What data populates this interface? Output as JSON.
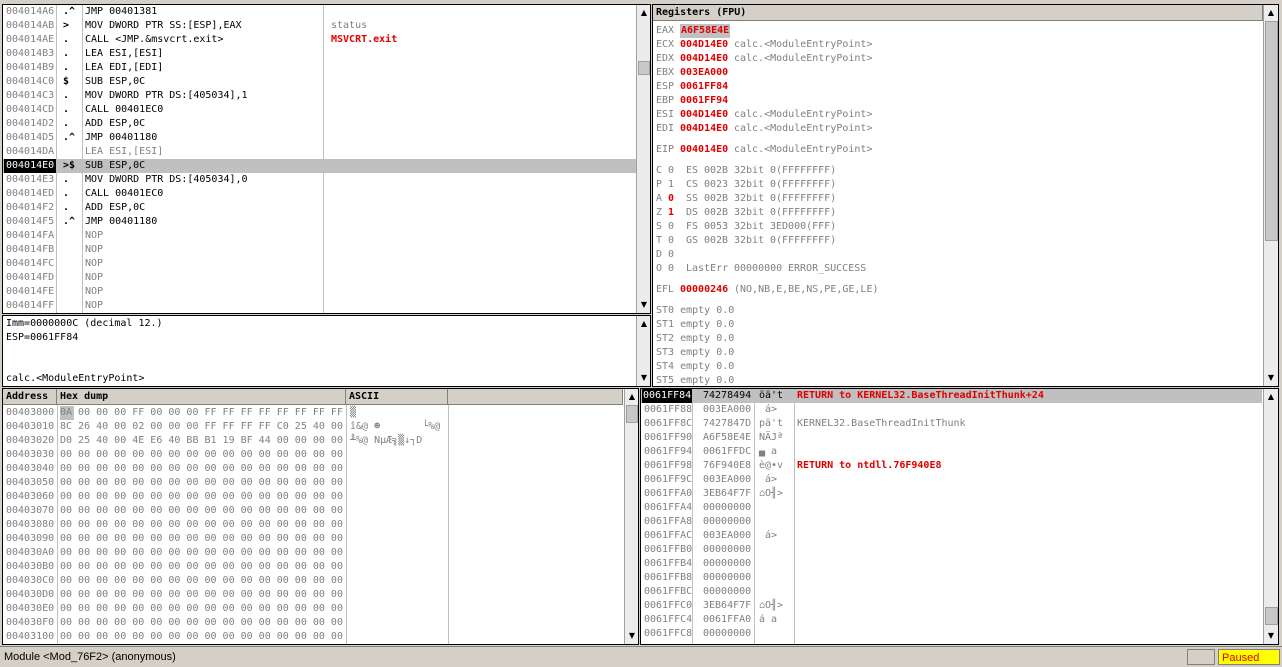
{
  "disasm": {
    "rows": [
      {
        "addr": "004014A6",
        "mark": ".^",
        "instr": "JMP 00401381",
        "comment": "",
        "addr_style": "gray"
      },
      {
        "addr": "004014AB",
        "mark": ">",
        "instr": "MOV DWORD PTR SS:[ESP],EAX",
        "comment": "status",
        "addr_style": "gray"
      },
      {
        "addr": "004014AE",
        "mark": ".",
        "instr": "CALL <JMP.&msvcrt.exit>",
        "comment": "MSVCRT.exit",
        "addr_style": "gray"
      },
      {
        "addr": "004014B3",
        "mark": ".",
        "instr": "LEA ESI,[ESI]",
        "comment": "",
        "addr_style": "gray"
      },
      {
        "addr": "004014B9",
        "mark": ".",
        "instr": "LEA EDI,[EDI]",
        "comment": "",
        "addr_style": "gray"
      },
      {
        "addr": "004014C0",
        "mark": "$",
        "instr": "SUB ESP,0C",
        "comment": "",
        "addr_style": "gray"
      },
      {
        "addr": "004014C3",
        "mark": ".",
        "instr": "MOV DWORD PTR DS:[405034],1",
        "comment": "",
        "addr_style": "gray"
      },
      {
        "addr": "004014CD",
        "mark": ".",
        "instr": "CALL 00401EC0",
        "comment": "",
        "addr_style": "gray"
      },
      {
        "addr": "004014D2",
        "mark": ".",
        "instr": "ADD ESP,0C",
        "comment": "",
        "addr_style": "gray"
      },
      {
        "addr": "004014D5",
        "mark": ".^",
        "instr": "JMP 00401180",
        "comment": "",
        "addr_style": "gray"
      },
      {
        "addr": "004014DA",
        "mark": "",
        "instr": "LEA ESI,[ESI]",
        "comment": "",
        "addr_style": "gray"
      },
      {
        "addr": "004014E0",
        "mark": ">$",
        "instr": "SUB ESP,0C",
        "comment": "",
        "addr_style": "current"
      },
      {
        "addr": "004014E3",
        "mark": ".",
        "instr": "MOV DWORD PTR DS:[405034],0",
        "comment": "",
        "addr_style": "gray"
      },
      {
        "addr": "004014ED",
        "mark": ".",
        "instr": "CALL 00401EC0",
        "comment": "",
        "addr_style": "gray"
      },
      {
        "addr": "004014F2",
        "mark": ".",
        "instr": "ADD ESP,0C",
        "comment": "",
        "addr_style": "gray"
      },
      {
        "addr": "004014F5",
        "mark": ".^",
        "instr": "JMP 00401180",
        "comment": "",
        "addr_style": "gray"
      },
      {
        "addr": "004014FA",
        "mark": "",
        "instr": "NOP",
        "comment": "",
        "addr_style": "gray"
      },
      {
        "addr": "004014FB",
        "mark": "",
        "instr": "NOP",
        "comment": "",
        "addr_style": "gray"
      },
      {
        "addr": "004014FC",
        "mark": "",
        "instr": "NOP",
        "comment": "",
        "addr_style": "gray"
      },
      {
        "addr": "004014FD",
        "mark": "",
        "instr": "NOP",
        "comment": "",
        "addr_style": "gray"
      },
      {
        "addr": "004014FE",
        "mark": "",
        "instr": "NOP",
        "comment": "",
        "addr_style": "gray"
      },
      {
        "addr": "004014FF",
        "mark": "",
        "instr": "NOP",
        "comment": "",
        "addr_style": "gray"
      }
    ]
  },
  "info": {
    "line1": "Imm=0000000C (decimal 12.)",
    "line2": "ESP=0061FF84",
    "line3": "calc.<ModuleEntryPoint>"
  },
  "registers": {
    "title": "Registers (FPU)",
    "gpr": [
      {
        "name": "EAX",
        "value": "A6F58E4E",
        "desc": "",
        "highlight": true
      },
      {
        "name": "ECX",
        "value": "004D14E0",
        "desc": "calc.<ModuleEntryPoint>"
      },
      {
        "name": "EDX",
        "value": "004D14E0",
        "desc": "calc.<ModuleEntryPoint>"
      },
      {
        "name": "EBX",
        "value": "003EA000",
        "desc": ""
      },
      {
        "name": "ESP",
        "value": "0061FF84",
        "desc": ""
      },
      {
        "name": "EBP",
        "value": "0061FF94",
        "desc": ""
      },
      {
        "name": "ESI",
        "value": "004D14E0",
        "desc": "calc.<ModuleEntryPoint>"
      },
      {
        "name": "EDI",
        "value": "004D14E0",
        "desc": "calc.<ModuleEntryPoint>"
      }
    ],
    "eip": {
      "name": "EIP",
      "value": "004014E0",
      "desc": "calc.<ModuleEntryPoint>"
    },
    "flags": [
      {
        "flag": "C",
        "val": "0",
        "seg": "ES",
        "sel": "002B",
        "bits": "32bit",
        "range": "0(FFFFFFFF)",
        "red": false
      },
      {
        "flag": "P",
        "val": "1",
        "seg": "CS",
        "sel": "0023",
        "bits": "32bit",
        "range": "0(FFFFFFFF)",
        "red": false
      },
      {
        "flag": "A",
        "val": "0",
        "seg": "SS",
        "sel": "002B",
        "bits": "32bit",
        "range": "0(FFFFFFFF)",
        "red": true
      },
      {
        "flag": "Z",
        "val": "1",
        "seg": "DS",
        "sel": "002B",
        "bits": "32bit",
        "range": "0(FFFFFFFF)",
        "red": true
      },
      {
        "flag": "S",
        "val": "0",
        "seg": "FS",
        "sel": "0053",
        "bits": "32bit",
        "range": "3ED000(FFF)",
        "red": false
      },
      {
        "flag": "T",
        "val": "0",
        "seg": "GS",
        "sel": "002B",
        "bits": "32bit",
        "range": "0(FFFFFFFF)",
        "red": false
      },
      {
        "flag": "D",
        "val": "0",
        "seg": "",
        "sel": "",
        "bits": "",
        "range": "",
        "red": false
      },
      {
        "flag": "O",
        "val": "0",
        "seg": "LastErr",
        "sel": "00000000",
        "bits": "ERROR_SUCCESS",
        "range": "",
        "red": false
      }
    ],
    "efl": {
      "name": "EFL",
      "value": "00000246",
      "desc": "(NO,NB,E,BE,NS,PE,GE,LE)"
    },
    "fpu": [
      "ST0 empty 0.0",
      "ST1 empty 0.0",
      "ST2 empty 0.0",
      "ST3 empty 0.0",
      "ST4 empty 0.0",
      "ST5 empty 0.0"
    ]
  },
  "dump": {
    "headers": {
      "address": "Address",
      "hex": "Hex dump",
      "ascii": "ASCII"
    },
    "rows": [
      {
        "addr": "00403000",
        "hex": "0A 00 00 00 FF 00 00 00 FF FF FF FF FF FF FF FF",
        "ascii": "▒"
      },
      {
        "addr": "00403010",
        "hex": "8C 26 40 00 02 00 00 00 FF FF FF FF C0 25 40 00",
        "ascii": "î&@ ☻       └%@"
      },
      {
        "addr": "00403020",
        "hex": "D0 25 40 00 4E E6 40 BB B1 19 BF 44 00 00 00 00",
        "ascii": "╨%@ NµÆ╗▒↓┐D"
      },
      {
        "addr": "00403030",
        "hex": "00 00 00 00 00 00 00 00 00 00 00 00 00 00 00 00",
        "ascii": ""
      },
      {
        "addr": "00403040",
        "hex": "00 00 00 00 00 00 00 00 00 00 00 00 00 00 00 00",
        "ascii": ""
      },
      {
        "addr": "00403050",
        "hex": "00 00 00 00 00 00 00 00 00 00 00 00 00 00 00 00",
        "ascii": ""
      },
      {
        "addr": "00403060",
        "hex": "00 00 00 00 00 00 00 00 00 00 00 00 00 00 00 00",
        "ascii": ""
      },
      {
        "addr": "00403070",
        "hex": "00 00 00 00 00 00 00 00 00 00 00 00 00 00 00 00",
        "ascii": ""
      },
      {
        "addr": "00403080",
        "hex": "00 00 00 00 00 00 00 00 00 00 00 00 00 00 00 00",
        "ascii": ""
      },
      {
        "addr": "00403090",
        "hex": "00 00 00 00 00 00 00 00 00 00 00 00 00 00 00 00",
        "ascii": ""
      },
      {
        "addr": "004030A0",
        "hex": "00 00 00 00 00 00 00 00 00 00 00 00 00 00 00 00",
        "ascii": ""
      },
      {
        "addr": "004030B0",
        "hex": "00 00 00 00 00 00 00 00 00 00 00 00 00 00 00 00",
        "ascii": ""
      },
      {
        "addr": "004030C0",
        "hex": "00 00 00 00 00 00 00 00 00 00 00 00 00 00 00 00",
        "ascii": ""
      },
      {
        "addr": "004030D0",
        "hex": "00 00 00 00 00 00 00 00 00 00 00 00 00 00 00 00",
        "ascii": ""
      },
      {
        "addr": "004030E0",
        "hex": "00 00 00 00 00 00 00 00 00 00 00 00 00 00 00 00",
        "ascii": ""
      },
      {
        "addr": "004030F0",
        "hex": "00 00 00 00 00 00 00 00 00 00 00 00 00 00 00 00",
        "ascii": ""
      },
      {
        "addr": "00403100",
        "hex": "00 00 00 00 00 00 00 00 00 00 00 00 00 00 00 00",
        "ascii": ""
      }
    ]
  },
  "stack": {
    "rows": [
      {
        "addr": "0061FF84",
        "value": "74278494",
        "ascii": "öä't",
        "comment": "RETURN to KERNEL32.BaseThreadInitThunk+24",
        "current": true,
        "comment_red": true
      },
      {
        "addr": "0061FF88",
        "value": "003EA000",
        "ascii": " á>",
        "comment": "",
        "current": false,
        "comment_red": false
      },
      {
        "addr": "0061FF8C",
        "value": "7427847D",
        "ascii": "pä't",
        "comment": "KERNEL32.BaseThreadInitThunk",
        "current": false,
        "comment_red": false
      },
      {
        "addr": "0061FF90",
        "value": "A6F58E4E",
        "ascii": "NÄJª",
        "comment": "",
        "current": false,
        "comment_red": false
      },
      {
        "addr": "0061FF94",
        "value": "0061FFDC",
        "ascii": "▄ a",
        "comment": "",
        "current": false,
        "comment_red": false
      },
      {
        "addr": "0061FF98",
        "value": "76F940E8",
        "ascii": "è@•v",
        "comment": "RETURN to ntdll.76F940E8",
        "current": false,
        "comment_red": true
      },
      {
        "addr": "0061FF9C",
        "value": "003EA000",
        "ascii": " á>",
        "comment": "",
        "current": false,
        "comment_red": false
      },
      {
        "addr": "0061FFA0",
        "value": "3EB64F7F",
        "ascii": "⌂O╢>",
        "comment": "",
        "current": false,
        "comment_red": false
      },
      {
        "addr": "0061FFA4",
        "value": "00000000",
        "ascii": "",
        "comment": "",
        "current": false,
        "comment_red": false
      },
      {
        "addr": "0061FFA8",
        "value": "00000000",
        "ascii": "",
        "comment": "",
        "current": false,
        "comment_red": false
      },
      {
        "addr": "0061FFAC",
        "value": "003EA000",
        "ascii": " á>",
        "comment": "",
        "current": false,
        "comment_red": false
      },
      {
        "addr": "0061FFB0",
        "value": "00000000",
        "ascii": "",
        "comment": "",
        "current": false,
        "comment_red": false
      },
      {
        "addr": "0061FFB4",
        "value": "00000000",
        "ascii": "",
        "comment": "",
        "current": false,
        "comment_red": false
      },
      {
        "addr": "0061FFB8",
        "value": "00000000",
        "ascii": "",
        "comment": "",
        "current": false,
        "comment_red": false
      },
      {
        "addr": "0061FFBC",
        "value": "00000000",
        "ascii": "",
        "comment": "",
        "current": false,
        "comment_red": false
      },
      {
        "addr": "0061FFC0",
        "value": "3EB64F7F",
        "ascii": "⌂O╢>",
        "comment": "",
        "current": false,
        "comment_red": false
      },
      {
        "addr": "0061FFC4",
        "value": "0061FFA0",
        "ascii": "á a",
        "comment": "",
        "current": false,
        "comment_red": false
      },
      {
        "addr": "0061FFC8",
        "value": "00000000",
        "ascii": "",
        "comment": "",
        "current": false,
        "comment_red": false
      }
    ]
  },
  "status": {
    "module": "Module <Mod_76F2> (anonymous)",
    "state": "Paused"
  },
  "colors": {
    "accent_red": "#e00000",
    "paused_bg": "#ffff00",
    "selection_bg": "#c0c0c0"
  }
}
